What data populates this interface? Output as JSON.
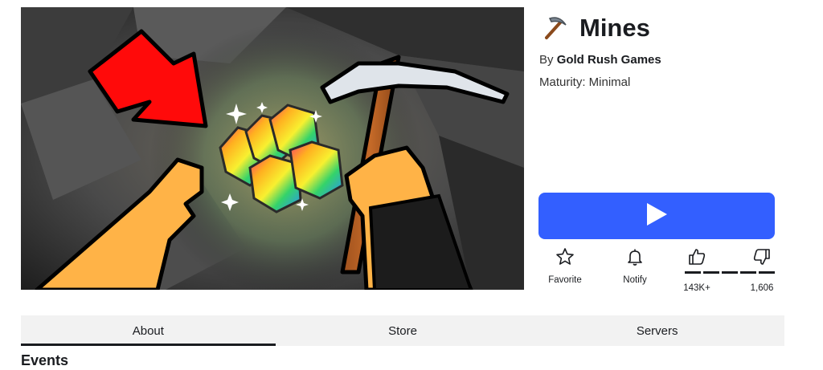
{
  "game": {
    "title": "Mines",
    "by_prefix": "By",
    "creator": "Gold Rush Games",
    "maturity": "Maturity: Minimal"
  },
  "icons": {
    "title_icon": "pickaxe-icon",
    "play": "play-icon",
    "favorite": "star-icon",
    "notify": "bell-icon",
    "upvote": "thumbs-up-icon",
    "downvote": "thumbs-down-icon"
  },
  "actions": {
    "favorite_label": "Favorite",
    "notify_label": "Notify",
    "upvotes": "143K+",
    "downvotes": "1,606"
  },
  "tabs": [
    {
      "label": "About",
      "active": true
    },
    {
      "label": "Store",
      "active": false
    },
    {
      "label": "Servers",
      "active": false
    }
  ],
  "section": {
    "title": "Events"
  },
  "colors": {
    "play_button": "#335fff",
    "text": "#1a1c20",
    "tab_bar": "#f2f2f2"
  }
}
